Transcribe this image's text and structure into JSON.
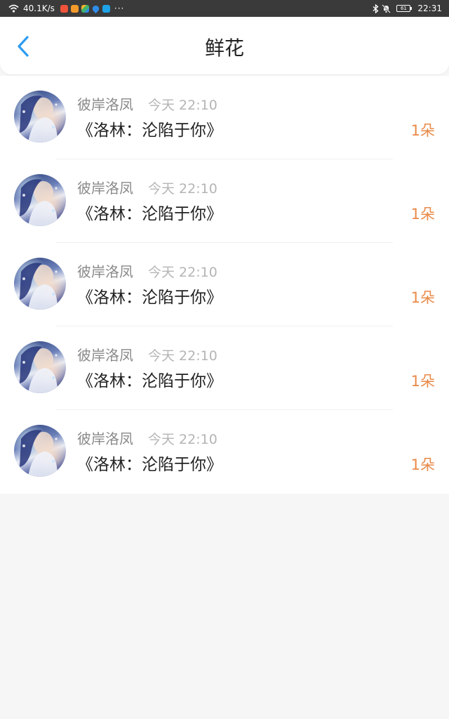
{
  "status_bar": {
    "speed": "40.1K/s",
    "overflow": "···",
    "battery": "61",
    "time": "22:31",
    "app_icons": [
      {
        "name": "app-icon-red",
        "color": "#f0533a"
      },
      {
        "name": "app-icon-orange",
        "color": "#f39a2b"
      },
      {
        "name": "app-icon-multicolor",
        "color": "#41b36b"
      },
      {
        "name": "app-icon-location",
        "color": "#2f8ce6"
      },
      {
        "name": "app-icon-search",
        "color": "#1fa3e8"
      }
    ]
  },
  "header": {
    "title": "鲜花",
    "back_icon": "chevron-left-icon",
    "accent": "#2d9cf0"
  },
  "items": [
    {
      "user": "彼岸洛凤",
      "time": "今天 22:10",
      "book": "《洛林：沦陷于你》",
      "count": "1朵"
    },
    {
      "user": "彼岸洛凤",
      "time": "今天 22:10",
      "book": "《洛林：沦陷于你》",
      "count": "1朵"
    },
    {
      "user": "彼岸洛凤",
      "time": "今天 22:10",
      "book": "《洛林：沦陷于你》",
      "count": "1朵"
    },
    {
      "user": "彼岸洛凤",
      "time": "今天 22:10",
      "book": "《洛林：沦陷于你》",
      "count": "1朵"
    },
    {
      "user": "彼岸洛凤",
      "time": "今天 22:10",
      "book": "《洛林：沦陷于你》",
      "count": "1朵"
    }
  ],
  "colors": {
    "count": "#e98a48",
    "background": "#f7f6f7"
  }
}
